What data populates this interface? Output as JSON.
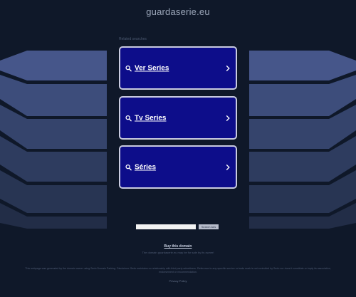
{
  "domain": "guardaserie.eu",
  "related_label": "Related searches",
  "links": [
    {
      "label": "Ver Series"
    },
    {
      "label": "Tv Series"
    },
    {
      "label": "Séries"
    }
  ],
  "search": {
    "placeholder": "",
    "button_label": "Search Ads"
  },
  "buy_link": "Buy this domain",
  "owner_text": "The domain guardaserie.eu may be for sale by its owner!",
  "disclaimer": "This webpage was generated by the domain owner using Sedo Domain Parking. Disclaimer: Sedo maintains no relationship with third party advertisers. Reference to any specific service or trade mark is not controlled by Sedo nor does it constitute or imply its association, endorsement or recommendation.",
  "privacy_link": "Privacy Policy",
  "colors": {
    "background": "#0f1829",
    "link_box": "#0d0d8a",
    "link_border": "#c9cbe0",
    "decor": "#3a4a72"
  }
}
